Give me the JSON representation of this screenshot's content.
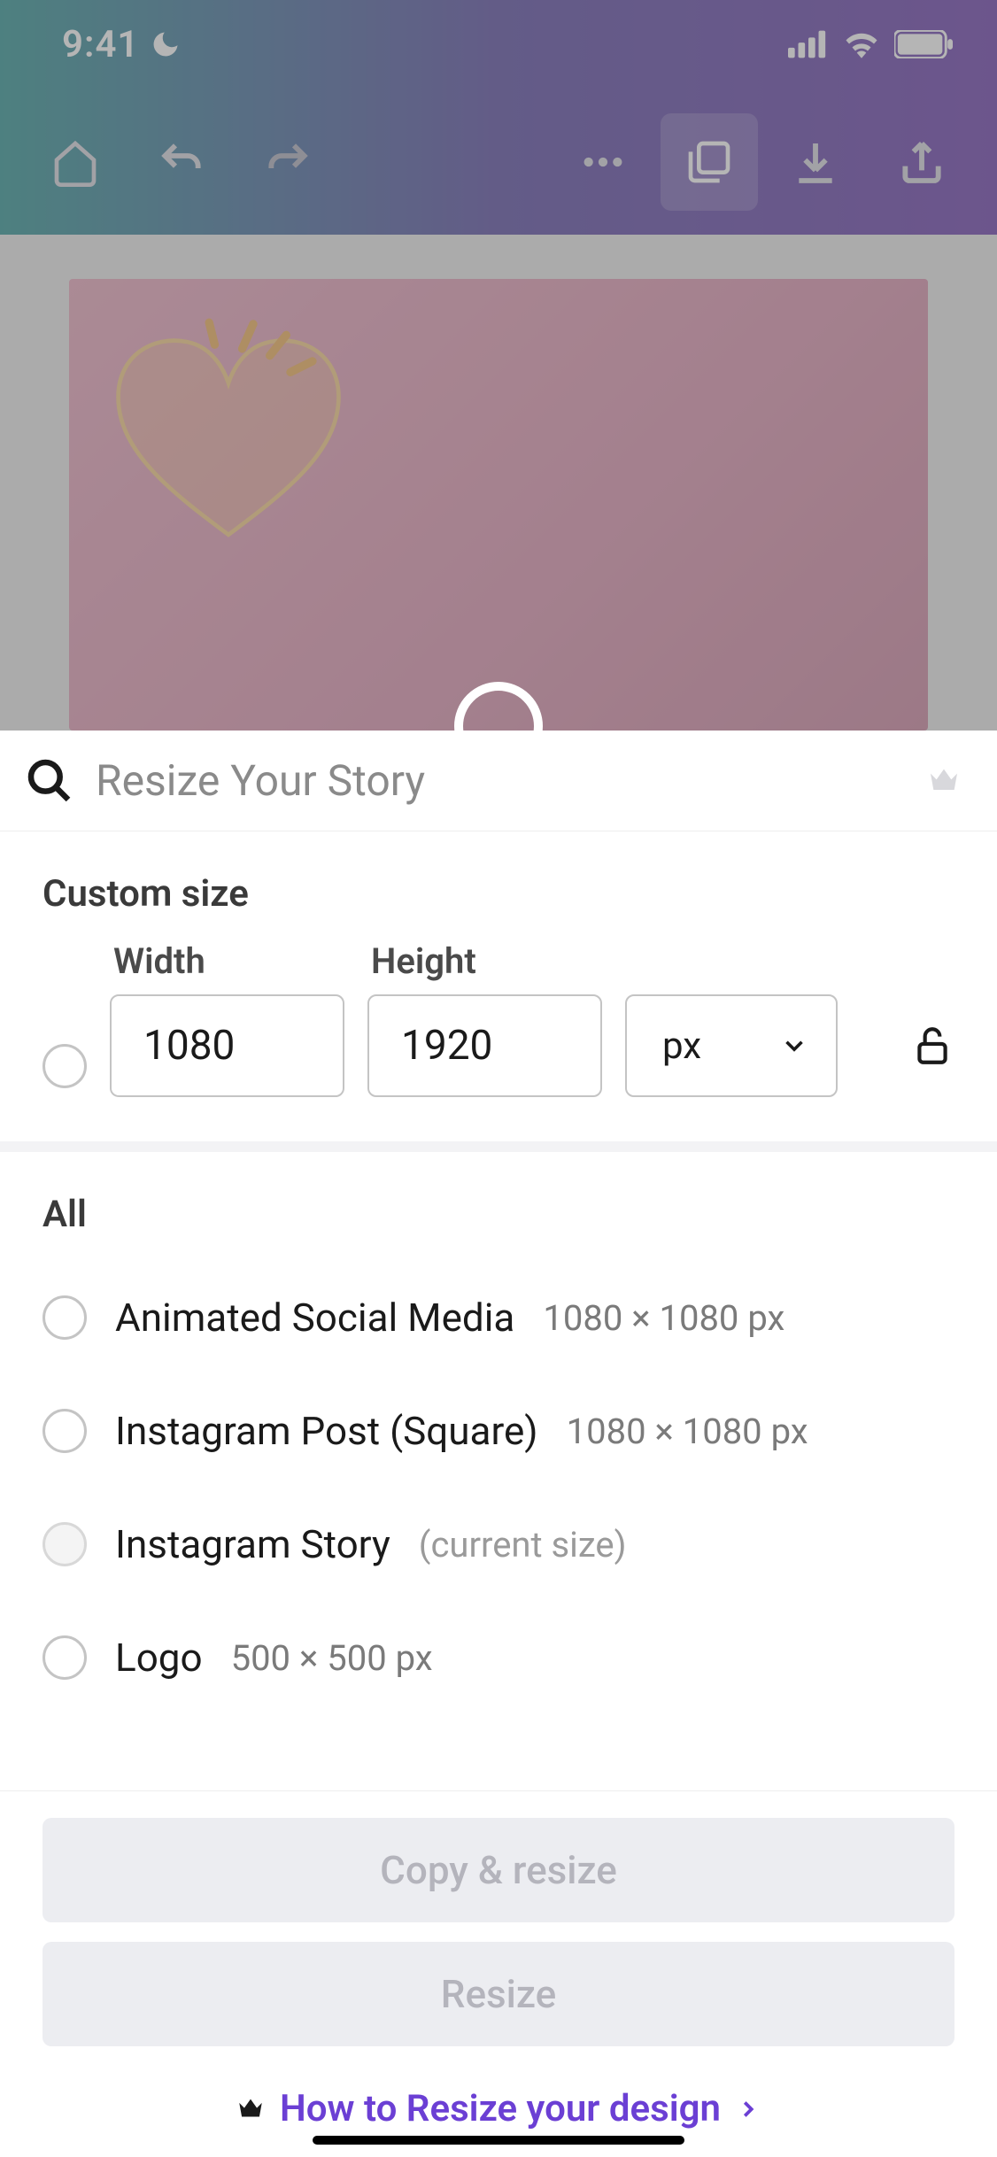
{
  "status": {
    "time": "9:41"
  },
  "sheet": {
    "search_placeholder": "Resize Your Story",
    "custom_section": "Custom size",
    "width_label": "Width",
    "height_label": "Height",
    "width_value": "1080",
    "height_value": "1920",
    "unit": "px",
    "all_section": "All",
    "presets": [
      {
        "name": "Animated Social Media",
        "dims": "1080 × 1080 px",
        "note": ""
      },
      {
        "name": "Instagram Post (Square)",
        "dims": "1080 × 1080 px",
        "note": ""
      },
      {
        "name": "Instagram Story",
        "dims": "",
        "note": "(current size)"
      },
      {
        "name": "Logo",
        "dims": "500 × 500 px",
        "note": ""
      }
    ],
    "copy_resize": "Copy & resize",
    "resize": "Resize",
    "howto": "How to Resize your design"
  }
}
